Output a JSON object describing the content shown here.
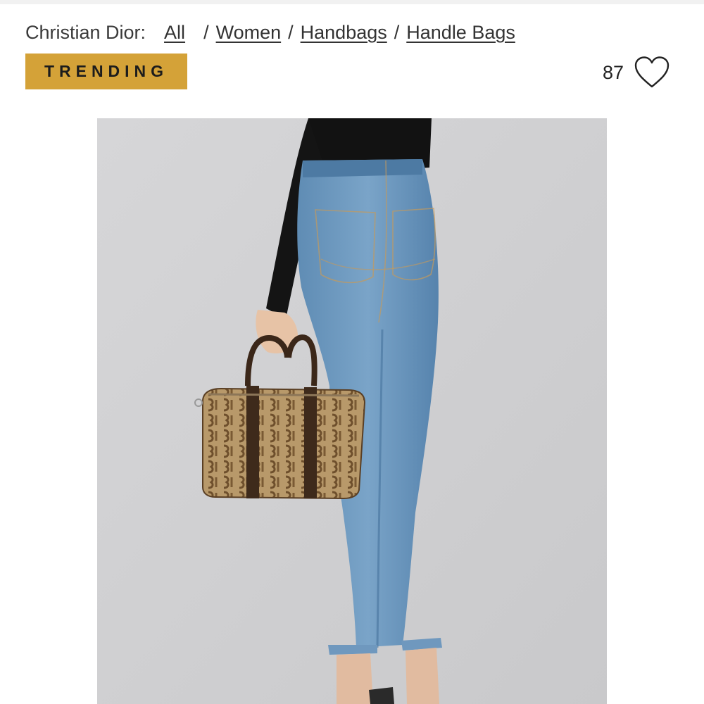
{
  "breadcrumb": {
    "brand": "Christian Dior:",
    "items": [
      {
        "label": "All"
      },
      {
        "label": "Women"
      },
      {
        "label": "Handbags"
      },
      {
        "label": "Handle Bags"
      }
    ],
    "separator": "/"
  },
  "badge": {
    "label": "TRENDING",
    "color": "#d4a238"
  },
  "favorites": {
    "count": "87",
    "icon": "heart-outline-icon"
  },
  "product_image": {
    "subject": "model in black top and light-wash jeans holding a monogram canvas handle bag"
  }
}
